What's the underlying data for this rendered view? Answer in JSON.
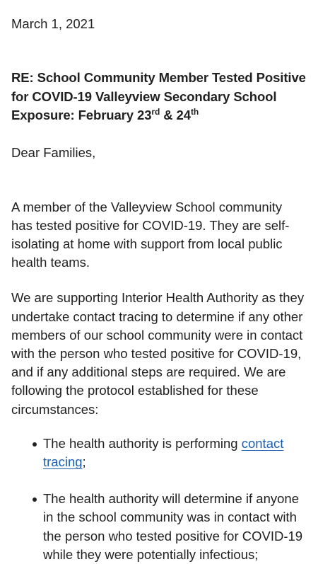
{
  "letter": {
    "date": "March 1, 2021",
    "subject": {
      "line_main": "RE: School Community Member Tested Positive for COVID-19 Valleyview Secondary School Exposure: February 23",
      "sup_1": "rd",
      "amp": " & 24",
      "sup_2": "th"
    },
    "greeting": "Dear Families,",
    "paragraph_1": "A member of the Valleyview School community has tested positive for COVID-19. They are self-isolating at home with support from local public health teams.",
    "paragraph_2": "We are supporting Interior Health Authority as they undertake contact tracing to determine if any other members of our school community were in contact with the person who tested positive for COVID-19, and if any additional steps are required. We are following the protocol established for these circumstances:",
    "bullets": [
      {
        "text_before": "The health authority is performing ",
        "link_text": "contact tracing",
        "text_after": ";"
      },
      {
        "text_before": "The health authority will determine if anyone in the school community was in contact with the person who tested positive for COVID-19 while they were potentially infectious;"
      }
    ]
  }
}
